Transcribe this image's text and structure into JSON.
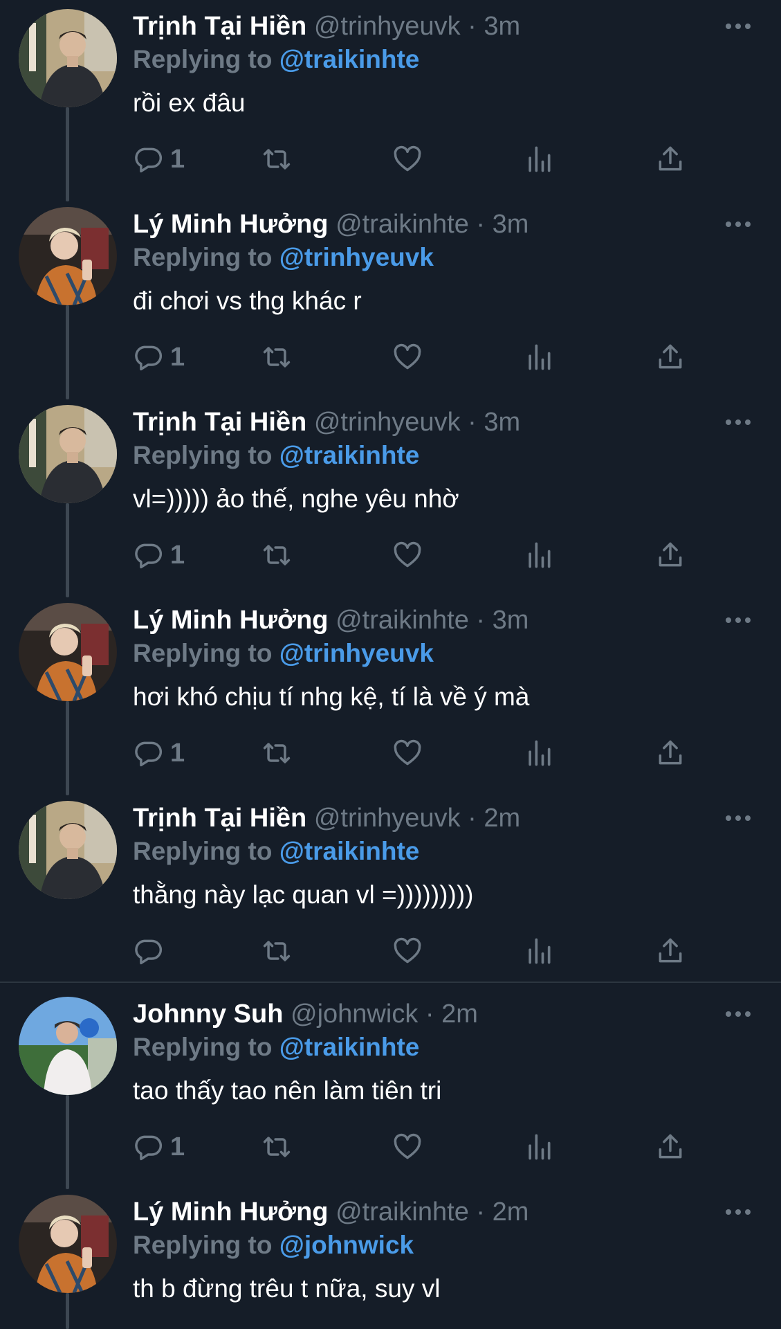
{
  "replying_prefix": "Replying to",
  "colors": {
    "background": "#151d28",
    "mention": "#4a9be8",
    "muted": "#6e7a86",
    "thread_line": "#3d4752"
  },
  "tweets": [
    {
      "name": "Trịnh Tại Hiền",
      "meta": "@trinhyeuvk · 3m",
      "reply_to": "@traikinhte",
      "text": "rồi ex đâu",
      "reply_count": "1",
      "avatar": "avatar-trinh"
    },
    {
      "name": "Lý Minh Hưởng",
      "meta": "@traikinhte · 3m",
      "reply_to": "@trinhyeuvk",
      "text": "đi chơi vs thg khác r",
      "reply_count": "1",
      "avatar": "avatar-ly"
    },
    {
      "name": "Trịnh Tại Hiền",
      "meta": "@trinhyeuvk · 3m",
      "reply_to": "@traikinhte",
      "text": "vl=))))) ảo thế, nghe yêu nhờ",
      "reply_count": "1",
      "avatar": "avatar-trinh"
    },
    {
      "name": "Lý Minh Hưởng",
      "meta": "@traikinhte · 3m",
      "reply_to": "@trinhyeuvk",
      "text": "hơi khó chịu tí nhg kệ, tí là về ý mà",
      "reply_count": "1",
      "avatar": "avatar-ly"
    },
    {
      "name": "Trịnh Tại Hiền",
      "meta": "@trinhyeuvk · 2m",
      "reply_to": "@traikinhte",
      "text": "thằng này lạc quan vl =)))))))))",
      "reply_count": "",
      "avatar": "avatar-trinh"
    },
    {
      "name": "Johnny Suh",
      "meta": "@johnwick · 2m",
      "reply_to": "@traikinhte",
      "text": "tao thấy tao nên làm tiên tri",
      "reply_count": "1",
      "avatar": "avatar-johnny"
    },
    {
      "name": "Lý Minh Hưởng",
      "meta": "@traikinhte · 2m",
      "reply_to": "@johnwick",
      "text": "th b đừng trêu t nữa, suy vl",
      "reply_count": "",
      "avatar": "avatar-ly"
    }
  ]
}
